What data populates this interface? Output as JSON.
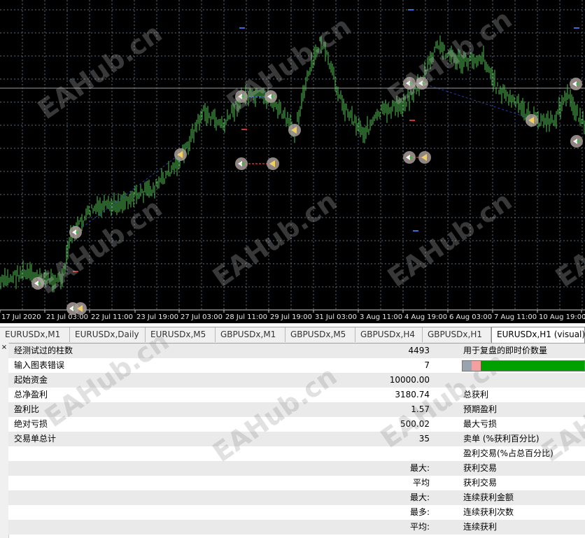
{
  "chart": {
    "time_labels": [
      "17 Jul 2020",
      "21 Jul 03:00",
      "22 Jul 11:00",
      "23 Jul 19:00",
      "27 Jul 03:00",
      "28 Jul 11:00",
      "29 Jul 19:00",
      "31 Jul 03:00",
      "3 Aug 11:00",
      "4 Aug 19:00",
      "6 Aug 03:00",
      "7 Aug 11:00",
      "10 Aug 19:00",
      "1"
    ],
    "watermark": "EAHub.cn",
    "colors": {
      "background": "#000000",
      "grid": "#5a6a7a",
      "candle": "#52c152",
      "buy_marker": "#ffffff",
      "sell_marker": "#f0d060",
      "marker_ring": "#a89c98"
    }
  },
  "tabs": [
    {
      "label": "EURUSDx,M1"
    },
    {
      "label": "EURUSDx,Daily"
    },
    {
      "label": "EURUSDx,M5"
    },
    {
      "label": "GBPUSDx,M1"
    },
    {
      "label": "GBPUSDx,M5"
    },
    {
      "label": "GBPUSDx,H4"
    },
    {
      "label": "GBPUSDx,H1"
    },
    {
      "label": "EURUSDx,H1 (visual)"
    }
  ],
  "report": {
    "collapse_icon": "×",
    "rows": [
      {
        "label": "经测试过的柱数",
        "value": "4493",
        "label2": "用于复盘的即时价数量"
      },
      {
        "label": "输入图表错误",
        "value": "7",
        "label2": ""
      },
      {
        "label": "起始资金",
        "value": "10000.00",
        "label2": ""
      },
      {
        "label": "总净盈利",
        "value": "3180.74",
        "label2": "总获利"
      },
      {
        "label": "盈利比",
        "value": "1.57",
        "label2": "预期盈利"
      },
      {
        "label": "绝对亏损",
        "value": "500.02",
        "label2": "最大亏损"
      },
      {
        "label": "交易单总计",
        "value": "35",
        "label2": "卖单 (%获利百分比)"
      },
      {
        "label": "",
        "value": "",
        "label2": "盈利交易(%占总百分比)"
      },
      {
        "label": "",
        "value": "最大:",
        "label2": "获利交易"
      },
      {
        "label": "",
        "value": "平均",
        "label2": "获利交易"
      },
      {
        "label": "",
        "value": "最大:",
        "label2": "连续获利金额"
      },
      {
        "label": "",
        "value": "最多:",
        "label2": "连续获利次数"
      },
      {
        "label": "",
        "value": "平均:",
        "label2": "连续获利"
      }
    ]
  }
}
